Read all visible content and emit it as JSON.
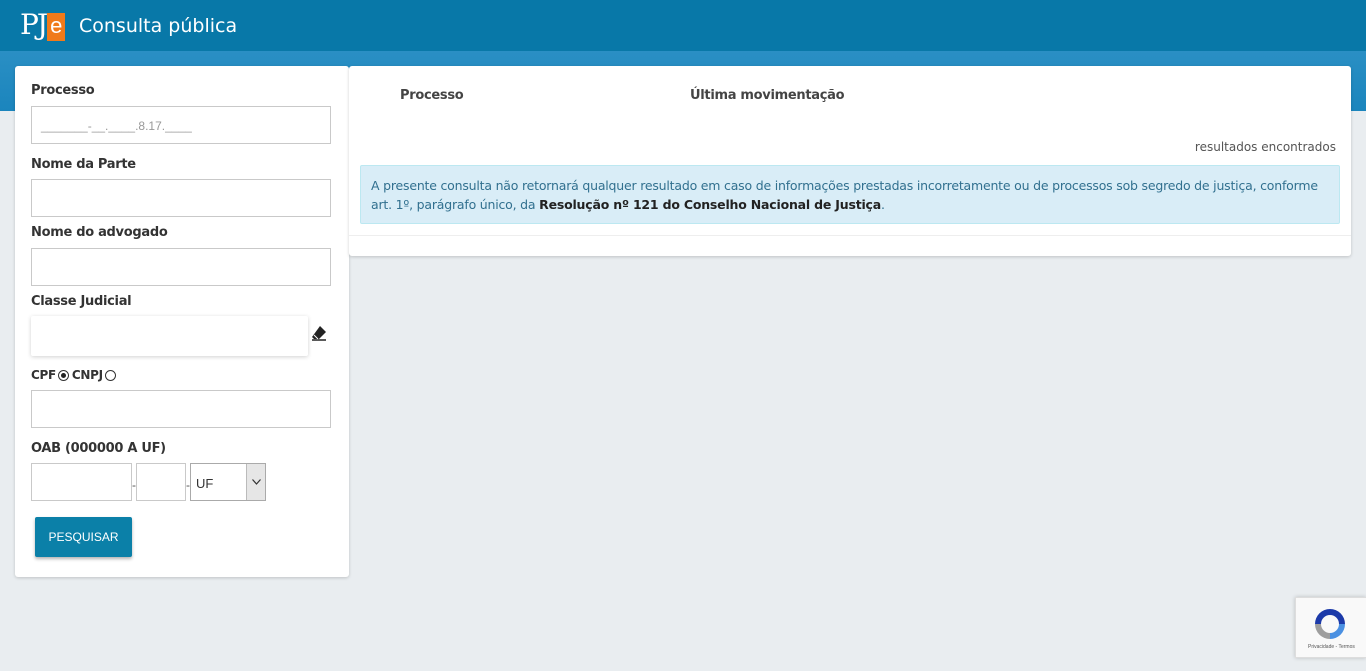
{
  "header": {
    "logo_text": "PJ",
    "logo_suffix": "e",
    "title": "Consulta pública"
  },
  "form": {
    "processo_label": "Processo",
    "processo_placeholder": "_______-__.____.8.17.____",
    "nome_parte_label": "Nome da Parte",
    "nome_advogado_label": "Nome do advogado",
    "classe_label": "Classe Judicial",
    "cpf_label": "CPF",
    "cnpj_label": "CNPJ",
    "doc_type_selected": "CPF",
    "oab_label": "OAB (000000 A UF)",
    "oab_separator": "-",
    "uf_select_value": "UF",
    "search_button": "PESQUISAR"
  },
  "results": {
    "col_processo": "Processo",
    "col_movimentacao": "Última movimentação",
    "count_text": "resultados encontrados",
    "notice_text": "A presente consulta não retornará qualquer resultado em caso de informações prestadas incorretamente ou de processos sob segredo de justiça, conforme art. 1º, parágrafo único, da ",
    "notice_bold": "Resolução nº 121 do Conselho Nacional de Justiça",
    "notice_end": "."
  },
  "recaptcha": {
    "footer": "Privacidade - Termos"
  },
  "colors": {
    "header": "#0878a8",
    "band": "#1b85bd",
    "button": "#0b80a8",
    "alert_bg": "#d9edf7",
    "logo_accent": "#f07a1a"
  }
}
